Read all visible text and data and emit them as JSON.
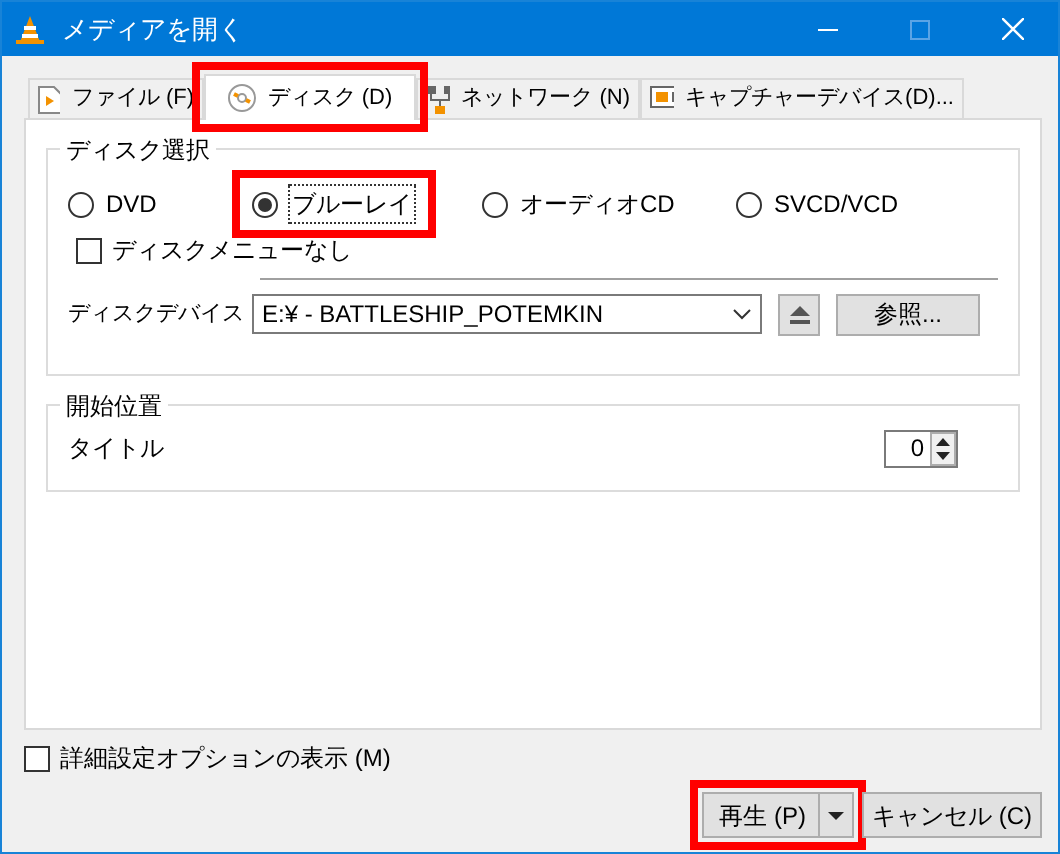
{
  "window": {
    "title": "メディアを開く"
  },
  "tabs": [
    {
      "label": "ファイル (F)",
      "selected": false,
      "highlighted": false
    },
    {
      "label": "ディスク (D)",
      "selected": true,
      "highlighted": true
    },
    {
      "label": "ネットワーク (N)",
      "selected": false,
      "highlighted": false
    },
    {
      "label": "キャプチャーデバイス(D)...",
      "selected": false,
      "highlighted": false
    }
  ],
  "disc_selection": {
    "title": "ディスク選択",
    "options": [
      {
        "label": "DVD",
        "selected": false,
        "highlighted": false
      },
      {
        "label": "ブルーレイ",
        "selected": true,
        "highlighted": true
      },
      {
        "label": "オーディオCD",
        "selected": false,
        "highlighted": false
      },
      {
        "label": "SVCD/VCD",
        "selected": false,
        "highlighted": false
      }
    ],
    "no_menu": {
      "label": "ディスクメニューなし",
      "checked": false
    },
    "device": {
      "label": "ディスクデバイス",
      "value": "E:¥ - BATTLESHIP_POTEMKIN"
    },
    "browse_button": "参照..."
  },
  "start_position": {
    "title": "開始位置",
    "title_label": "タイトル",
    "title_value": "0"
  },
  "advanced_options": {
    "label": "詳細設定オプションの表示 (M)",
    "checked": false
  },
  "buttons": [
    {
      "label": "再生 (P)",
      "kind": "split",
      "highlighted": true
    },
    {
      "label": "キャンセル (C)",
      "kind": "plain",
      "highlighted": false
    }
  ]
}
